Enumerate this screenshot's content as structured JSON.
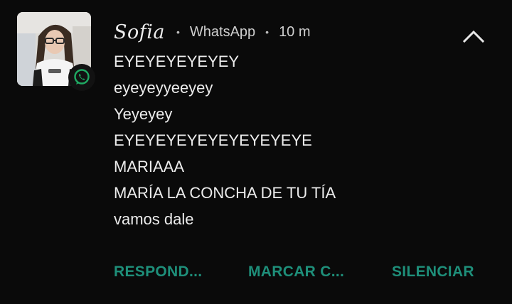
{
  "notification": {
    "sender": "Sofia",
    "app": "WhatsApp",
    "time": "10 m",
    "separator": "•",
    "avatar_icon": "profile-photo",
    "badge_icon": "whatsapp-icon",
    "collapse_icon": "chevron-up-icon",
    "messages": [
      "EYEYEYEYEYEY",
      "eyeyeyyeeyey",
      "Yeyeyey",
      "EYEYEYEYEYEYEYEYEYE",
      "MARIAAA",
      "MARÍA LA CONCHA DE TU TÍA",
      "vamos dale"
    ],
    "actions": {
      "reply": "RESPOND...",
      "mark_read": "MARCAR C...",
      "mute": "SILENCIAR"
    }
  },
  "colors": {
    "background": "#0a0a0a",
    "text": "#ececec",
    "meta_text": "#cfcfcf",
    "action": "#1e8f7a",
    "whatsapp_green": "#1faa63"
  }
}
